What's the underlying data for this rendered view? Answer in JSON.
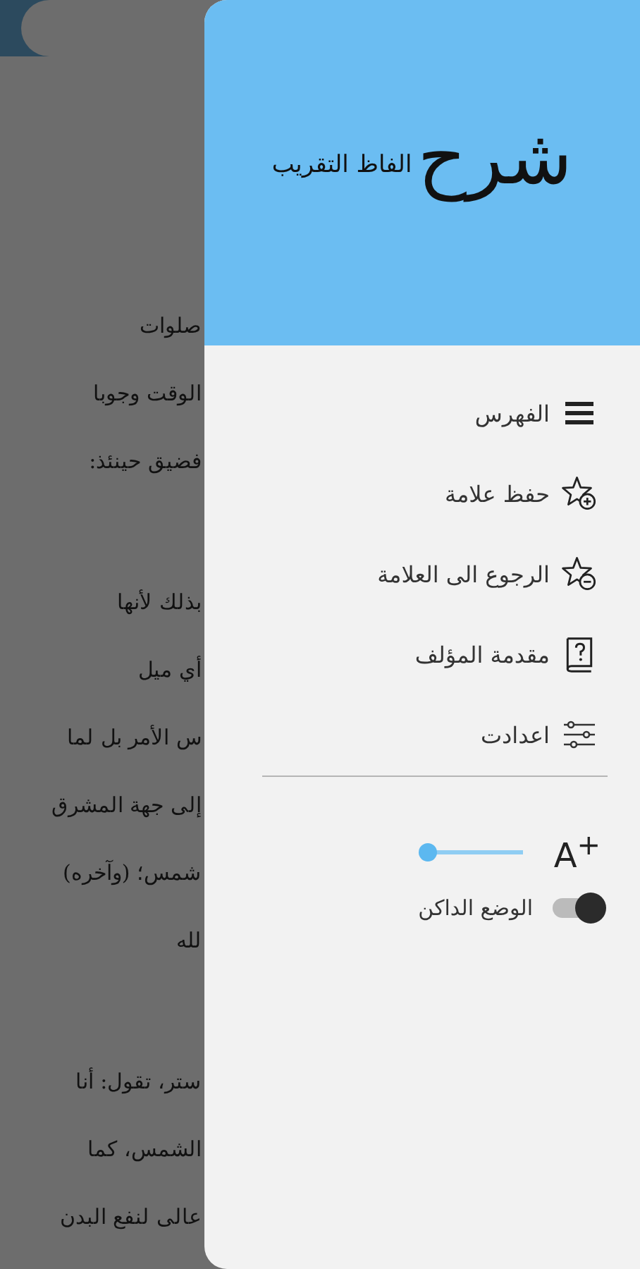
{
  "background_page": {
    "paragraphs": [
      [
        "صلوات",
        "الوقت وجوبا",
        "فضيق حينئذ:"
      ],
      [
        "بذلك لأنها",
        "أي ميل",
        "س الأمر بل لما",
        "إلى جهة المشرق",
        "شمس؛ (وآخره)",
        "لله"
      ],
      [
        "ستر، تقول: أنا",
        "الشمس، كما",
        "عالى لنفع البدن"
      ]
    ]
  },
  "drawer": {
    "logo": {
      "title": "شرح",
      "subtitle": "الفاظ التقريب"
    },
    "menu_items": [
      {
        "kind": "index",
        "label": "الفهرس"
      },
      {
        "kind": "save_bookmark",
        "label": "حفظ علامة"
      },
      {
        "kind": "go_to_bookmark",
        "label": "الرجوع الى العلامة"
      },
      {
        "kind": "author_intro",
        "label": "مقدمة المؤلف"
      },
      {
        "kind": "settings",
        "label": "اعدادت"
      }
    ],
    "font_size": {
      "label": "A$^{+}$",
      "level": 0
    },
    "dark_mode": {
      "label": "الوضع الداكن",
      "on": false
    }
  }
}
